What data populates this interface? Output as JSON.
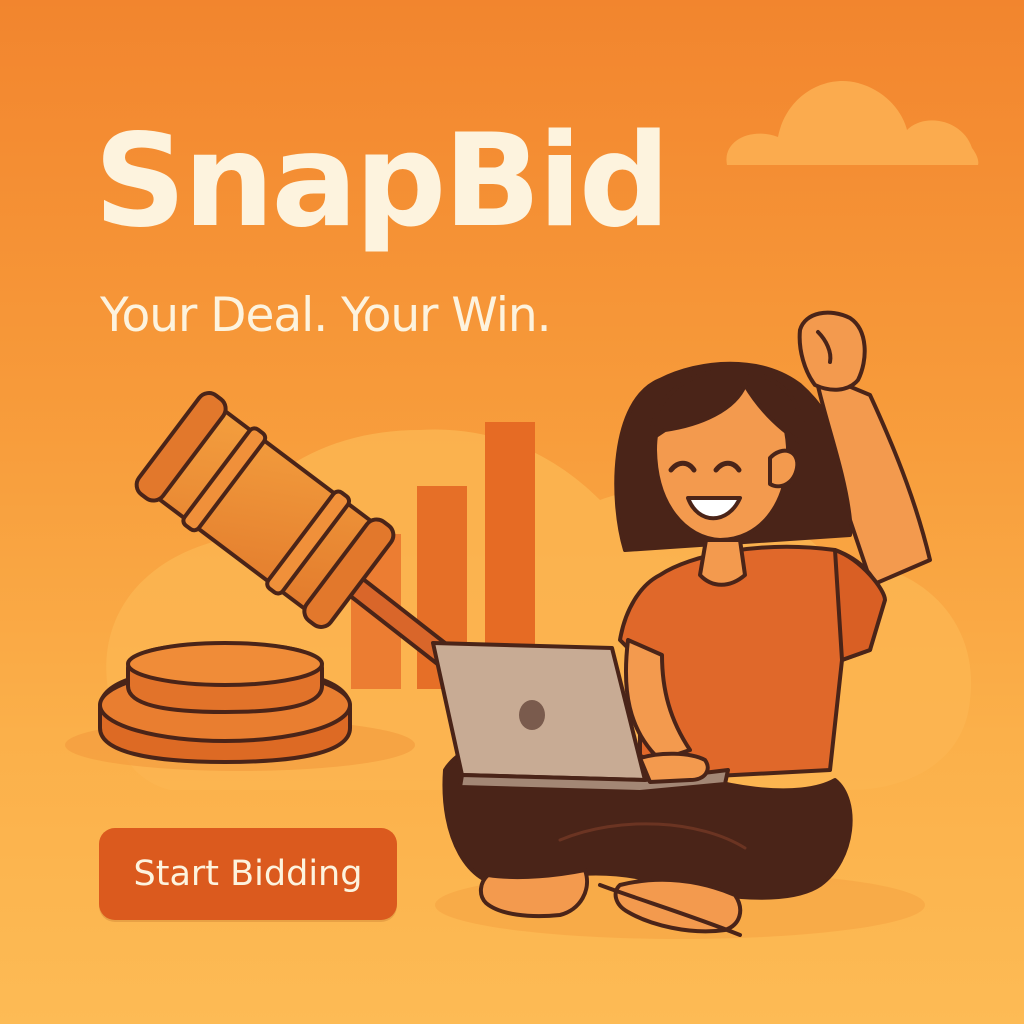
{
  "brand": {
    "name": "SnapBid",
    "tagline": "Your Deal. Your Win."
  },
  "cta": {
    "label": "Start Bidding"
  },
  "colors": {
    "background_top": "#f2852e",
    "background_bottom": "#fdbb55",
    "text_cream": "#fdf3de",
    "button": "#db5a1e",
    "outline": "#4a2418",
    "shirt": "#e0682a"
  },
  "illustration": {
    "icons": [
      "cloud-icon",
      "gavel-icon",
      "sound-block-icon",
      "bar-chart-icon",
      "laptop-icon"
    ],
    "chart_bar_levels": [
      0.55,
      0.7,
      1.0
    ]
  }
}
